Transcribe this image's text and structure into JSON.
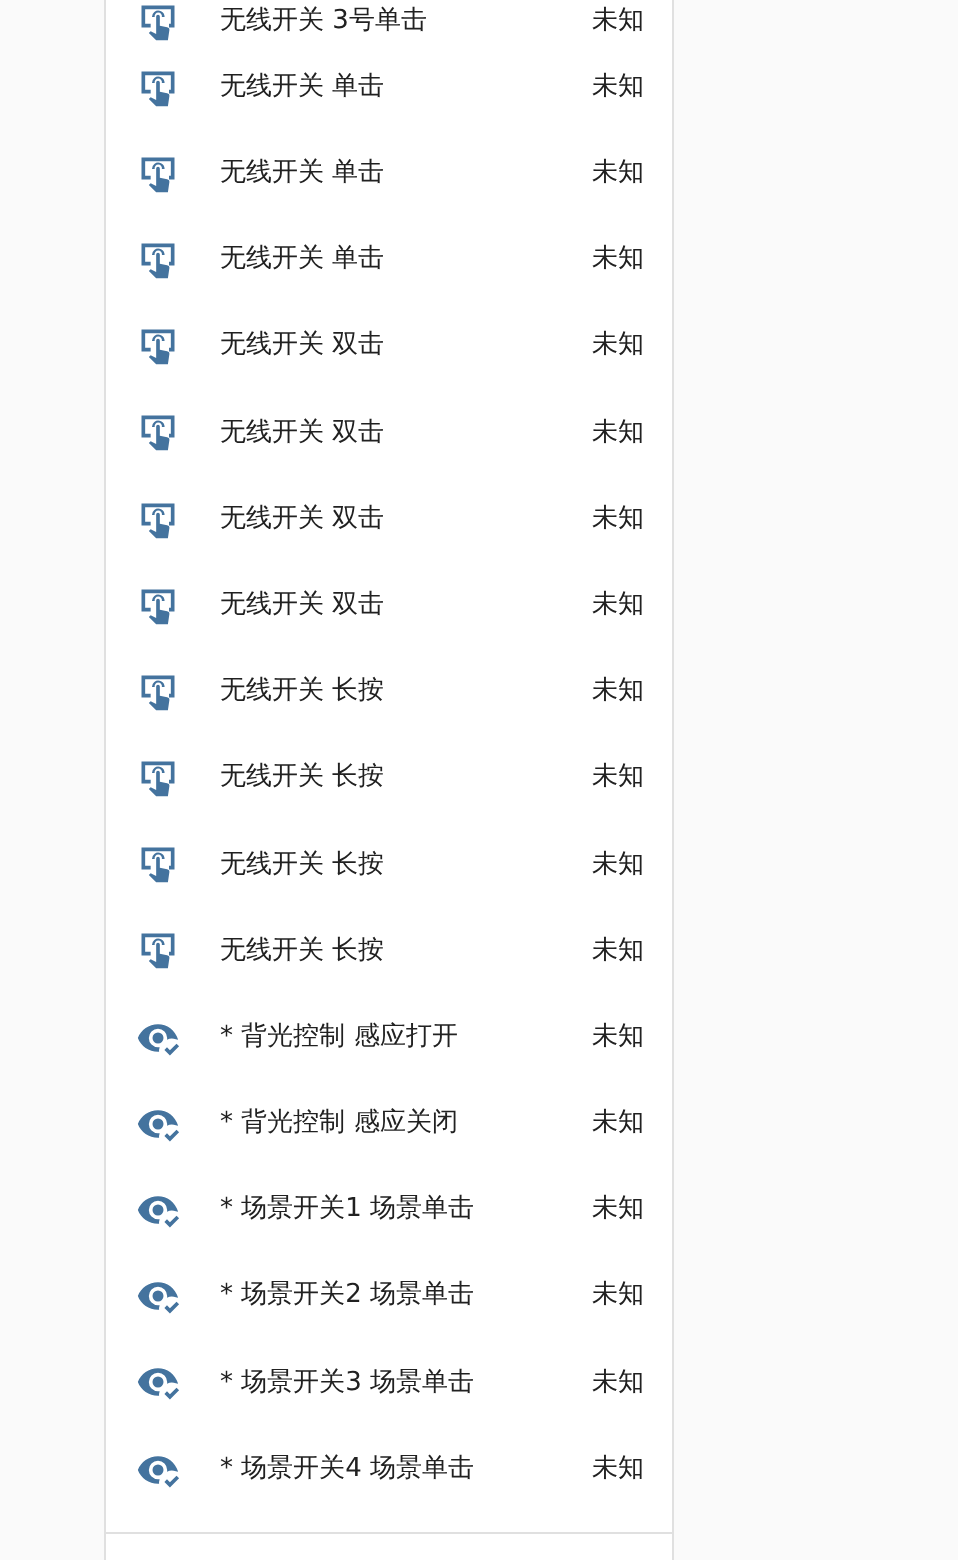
{
  "entities": [
    {
      "kind": "touch",
      "name": "无线开关 3号单击",
      "state": "未知"
    },
    {
      "kind": "touch",
      "name": "无线开关 单击",
      "state": "未知"
    },
    {
      "kind": "touch",
      "name": "无线开关 单击",
      "state": "未知"
    },
    {
      "kind": "touch",
      "name": "无线开关 单击",
      "state": "未知"
    },
    {
      "kind": "touch",
      "name": "无线开关 双击",
      "state": "未知"
    },
    {
      "kind": "touch",
      "name": "无线开关 双击",
      "state": "未知"
    },
    {
      "kind": "touch",
      "name": "无线开关 双击",
      "state": "未知"
    },
    {
      "kind": "touch",
      "name": "无线开关 双击",
      "state": "未知"
    },
    {
      "kind": "touch",
      "name": "无线开关 长按",
      "state": "未知"
    },
    {
      "kind": "touch",
      "name": "无线开关 长按",
      "state": "未知"
    },
    {
      "kind": "touch",
      "name": "无线开关 长按",
      "state": "未知"
    },
    {
      "kind": "touch",
      "name": "无线开关 长按",
      "state": "未知"
    },
    {
      "kind": "eye",
      "name": "* 背光控制 感应打开",
      "state": "未知"
    },
    {
      "kind": "eye",
      "name": "* 背光控制 感应关闭",
      "state": "未知"
    },
    {
      "kind": "eye",
      "name": "* 场景开关1 场景单击",
      "state": "未知"
    },
    {
      "kind": "eye",
      "name": "* 场景开关2 场景单击",
      "state": "未知"
    },
    {
      "kind": "eye",
      "name": "* 场景开关3 场景单击",
      "state": "未知"
    },
    {
      "kind": "eye",
      "name": "* 场景开关4 场景单击",
      "state": "未知"
    }
  ]
}
